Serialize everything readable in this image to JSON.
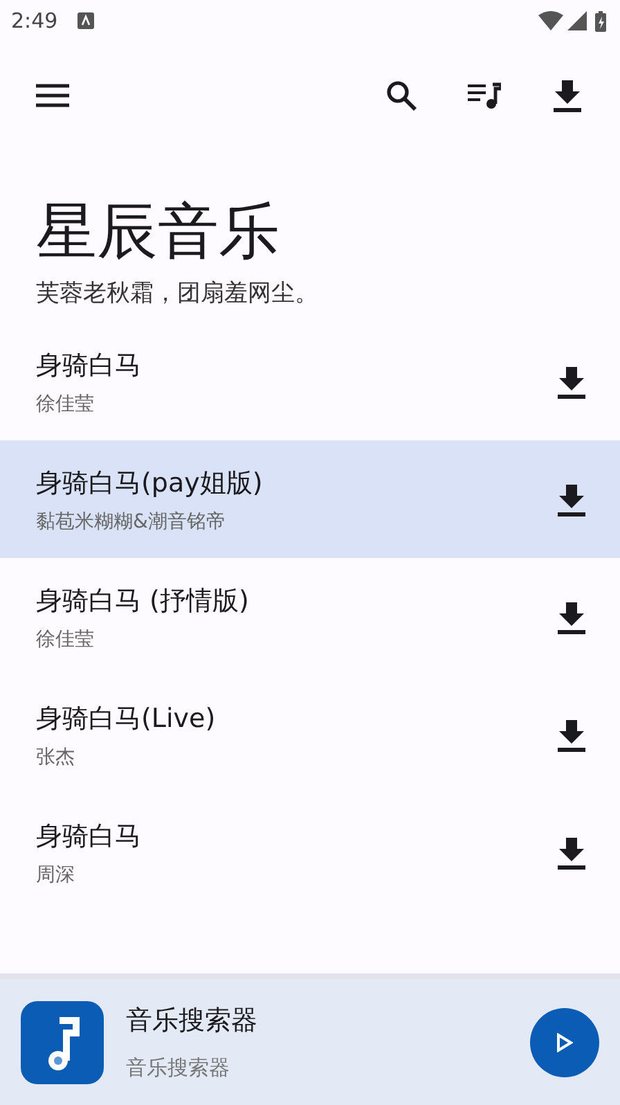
{
  "status_bar": {
    "time": "2:49"
  },
  "header": {
    "title": "星辰音乐",
    "subtitle": "芙蓉老秋霜，团扇羞网尘。"
  },
  "songs": [
    {
      "title": "身骑白马",
      "artist": "徐佳莹",
      "selected": false
    },
    {
      "title": "身骑白马(pay姐版)",
      "artist": "黏苞米糊糊&潮音铭帝",
      "selected": true
    },
    {
      "title": "身骑白马 (抒情版)",
      "artist": "徐佳莹",
      "selected": false
    },
    {
      "title": "身骑白马(Live)",
      "artist": "张杰",
      "selected": false
    },
    {
      "title": "身骑白马",
      "artist": "周深",
      "selected": false
    }
  ],
  "player": {
    "title": "音乐搜索器",
    "subtitle": "音乐搜索器"
  }
}
